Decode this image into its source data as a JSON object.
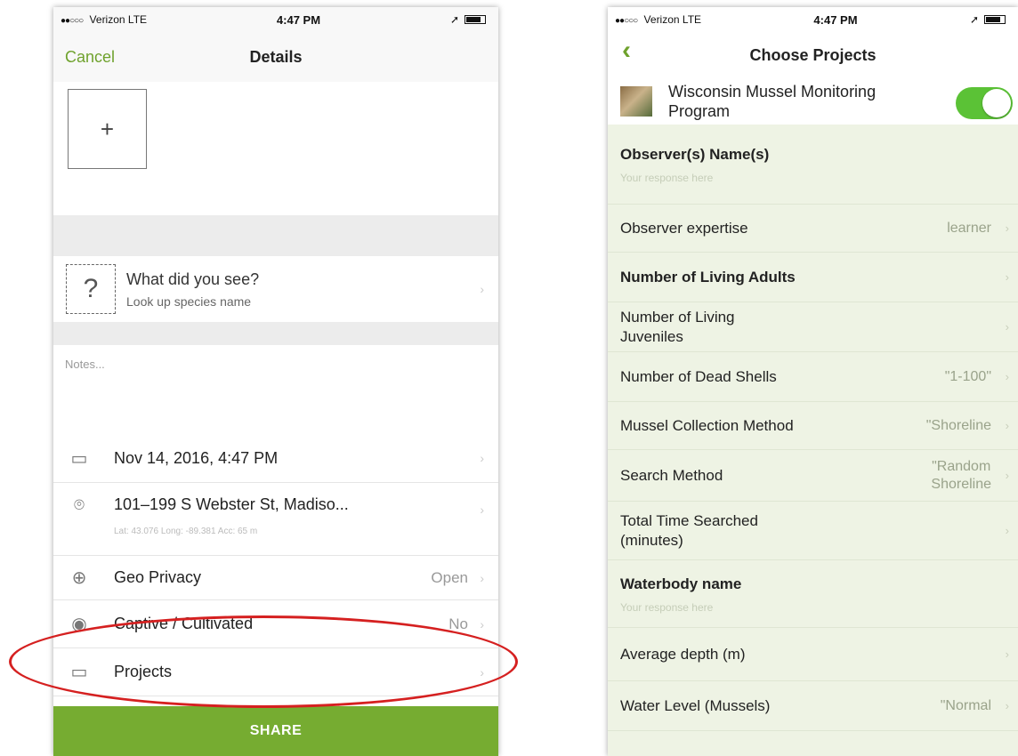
{
  "left": {
    "status": {
      "carrier": "Verizon",
      "network": "LTE",
      "time": "4:47 PM"
    },
    "nav": {
      "cancel": "Cancel",
      "title": "Details"
    },
    "photo_add": "+",
    "species": {
      "title": "What did you see?",
      "subtitle": "Look up species name"
    },
    "notes_placeholder": "Notes...",
    "date": "Nov 14, 2016, 4:47 PM",
    "location": {
      "address": "101–199 S Webster St, Madiso...",
      "coords": "Lat: 43.076  Long: -89.381  Acc: 65 m"
    },
    "geo_privacy": {
      "label": "Geo Privacy",
      "value": "Open"
    },
    "captive": {
      "label": "Captive / Cultivated",
      "value": "No"
    },
    "projects": {
      "label": "Projects"
    },
    "share": "SHARE"
  },
  "right": {
    "status": {
      "carrier": "Verizon",
      "network": "LTE",
      "time": "4:47 PM"
    },
    "nav": {
      "title": "Choose Projects"
    },
    "project": {
      "name_line1": "Wisconsin Mussel Monitoring",
      "name_line2": "Program",
      "enabled": true
    },
    "fields": [
      {
        "label": "Observer(s) Name(s)",
        "placeholder": "Your response here"
      },
      {
        "label": "Observer expertise",
        "value": "learner"
      },
      {
        "label": "Number of Living Adults"
      },
      {
        "label_line1": "Number of Living",
        "label_line2": "Juveniles"
      },
      {
        "label": "Number of Dead Shells",
        "value": "\"1-100\""
      },
      {
        "label": "Mussel Collection Method",
        "value": "\"Shoreline"
      },
      {
        "label": "Search Method",
        "value_line1": "\"Random",
        "value_line2": "Shoreline"
      },
      {
        "label_line1": "Total Time Searched",
        "label_line2": "(minutes)"
      },
      {
        "label": "Waterbody name",
        "placeholder": "Your response here"
      },
      {
        "label": "Average depth (m)"
      },
      {
        "label": "Water Level (Mussels)",
        "value": "\"Normal"
      }
    ]
  },
  "colors": {
    "accent": "#76ac31",
    "toggle": "#5bc236",
    "highlight": "#d52020"
  }
}
